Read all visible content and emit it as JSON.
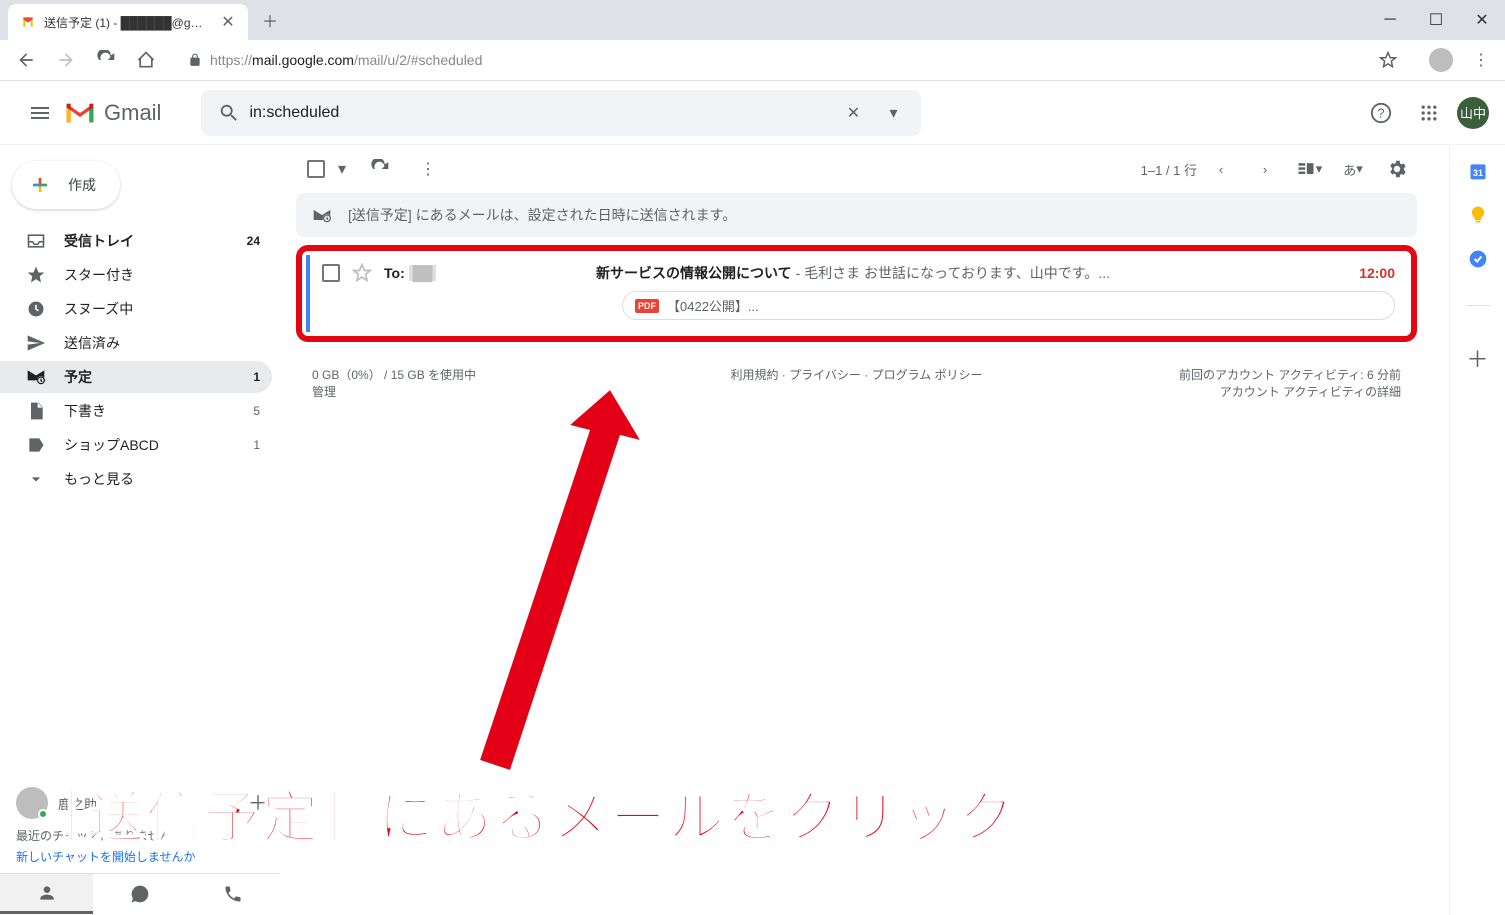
{
  "browser": {
    "tab_title": "送信予定 (1) - ██████@g…",
    "url": "https://mail.google.com/mail/u/2/#scheduled",
    "url_prefix": "https://",
    "url_host": "mail.google.com",
    "url_path": "/mail/u/2/#scheduled"
  },
  "gmail": {
    "logo_text": "Gmail",
    "search_value": "in:scheduled",
    "avatar_text": "山中"
  },
  "compose_label": "作成",
  "sidebar": {
    "items": [
      {
        "icon": "inbox",
        "label": "受信トレイ",
        "count": "24",
        "bold": true
      },
      {
        "icon": "star",
        "label": "スター付き",
        "count": ""
      },
      {
        "icon": "clock",
        "label": "スヌーズ中",
        "count": ""
      },
      {
        "icon": "send",
        "label": "送信済み",
        "count": ""
      },
      {
        "icon": "scheduled",
        "label": "予定",
        "count": "1",
        "active": true
      },
      {
        "icon": "draft",
        "label": "下書き",
        "count": "5"
      },
      {
        "icon": "label",
        "label": "ショップABCD",
        "count": "1"
      },
      {
        "icon": "expand",
        "label": "もっと見る",
        "count": ""
      }
    ]
  },
  "toolbar": {
    "page_info": "1–1 / 1 行",
    "lang": "あ"
  },
  "banner": "[送信予定] にあるメールは、設定された日時に送信されます。",
  "email": {
    "to_prefix": "To:",
    "to_name": "██",
    "subject": "新サービスの情報公開について",
    "snippet": " - 毛利さま お世話になっております、山中です。...",
    "time": "12:00",
    "attachment": "【0422公開】..."
  },
  "footer": {
    "storage": "0 GB（0%） / 15 GB を使用中",
    "manage": "管理",
    "terms": "利用規約",
    "privacy": "プライバシー",
    "policy": "プログラム ポリシー",
    "activity1": "前回のアカウント アクティビティ: 6 分前",
    "activity2": "アカウント アクティビティの詳細"
  },
  "hangouts": {
    "user": "鹿之助",
    "text_line": "最近のチャットはありません",
    "link": "新しいチャットを開始しませんか"
  },
  "annotation": "［送信予定］にあるメールをクリック"
}
